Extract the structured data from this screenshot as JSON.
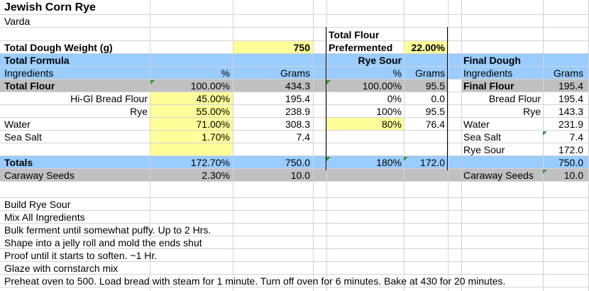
{
  "title": "Jewish Corn Rye",
  "author": "Varda",
  "total_flour_label_1": "Total Flour",
  "total_flour_label_2": "Prefermented",
  "total_dough_weight_label": "Total Dough Weight (g)",
  "total_dough_weight_value": "750",
  "preferment_percent": "22.00%",
  "sections": {
    "total_formula": "Total Formula",
    "rye_sour": "Rye Sour",
    "final_dough": "Final Dough"
  },
  "headers": {
    "ingredients": "Ingredients",
    "percent": "%",
    "grams": "Grams",
    "sour_percent": "%",
    "sour_grams": "Grams",
    "final_ingredients": "Ingredients",
    "final_grams": "Grams"
  },
  "total_flour": {
    "label": "Total Flour",
    "pct": "100.00%",
    "grams": "434.3",
    "sour_pct": "100.00%",
    "sour_grams": "95.5",
    "final_label": "Final Flour",
    "final_grams": "195.4"
  },
  "hi_gl": {
    "label": "Hi-Gl Bread Flour",
    "pct": "45.00%",
    "grams": "195.4",
    "sour_pct": "0%",
    "sour_grams": "0.0",
    "final_label": "Bread Flour",
    "final_grams": "195.4"
  },
  "rye": {
    "label": "Rye",
    "pct": "55.00%",
    "grams": "238.9",
    "sour_pct": "100%",
    "sour_grams": "95.5",
    "final_label": "Rye",
    "final_grams": "143.3"
  },
  "water": {
    "label": "Water",
    "pct": "71.00%",
    "grams": "308.3",
    "sour_pct": "80%",
    "sour_grams": "76.4",
    "final_label": "Water",
    "final_grams": "231.9"
  },
  "salt": {
    "label": "Sea Salt",
    "pct": "1.70%",
    "grams": "7.4",
    "final_label": "Sea Salt",
    "final_grams": "7.4"
  },
  "rye_sour_row": {
    "final_label": "Rye Sour",
    "final_grams": "172.0"
  },
  "totals": {
    "label": "Totals",
    "pct": "172.70%",
    "grams": "750.0",
    "sour_pct": "180%",
    "sour_grams": "172.0",
    "final_grams": "750.0"
  },
  "caraway": {
    "label": "Caraway Seeds",
    "pct": "2.30%",
    "grams": "10.0",
    "final_label": "Caraway Seeds",
    "final_grams": "10.0"
  },
  "instructions": [
    "Build Rye Sour",
    "Mix All Ingredients",
    "Bulk ferment until somewhat puffy.  Up to 2 Hrs.",
    "Shape into a jelly roll and mold the ends shut",
    "Proof until it starts to soften.  ~1 Hr.",
    "Glaze with cornstarch mix",
    "Preheat oven to 500.  Load bread with steam for 1 minute.  Turn off oven for 6 minutes.  Bake at 430 for 20 minutes."
  ],
  "colors": {
    "header_blue": "#99ccff",
    "total_gray": "#c0c0c0",
    "input_yellow": "#ffff99",
    "comment_green": "#2e9a2e"
  }
}
